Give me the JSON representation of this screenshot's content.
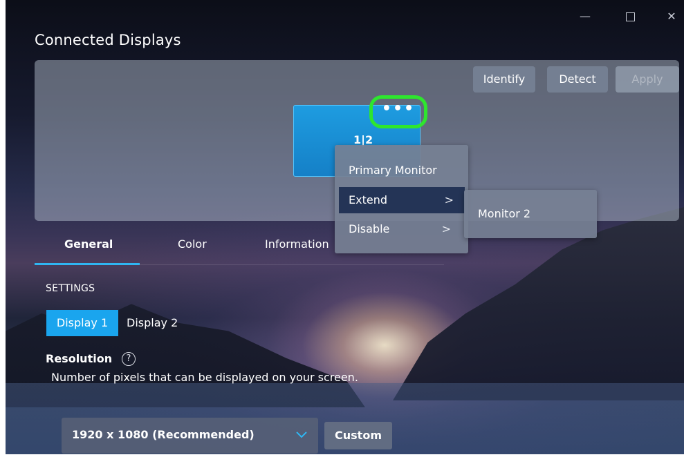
{
  "window": {
    "title": "Connected Displays",
    "controls": {
      "minimize": "—",
      "close": "✕"
    }
  },
  "top_actions": {
    "identify": "Identify",
    "detect": "Detect",
    "apply": "Apply"
  },
  "display_arrangement": {
    "monitor_label": "1|2",
    "more_button": "•••"
  },
  "context_menu": {
    "items": [
      {
        "label": "Primary Monitor"
      },
      {
        "label": "Extend",
        "submenu_arrow": ">"
      },
      {
        "label": "Disable",
        "submenu_arrow": ">"
      }
    ],
    "selected": "Extend"
  },
  "submenu": {
    "items": [
      {
        "label": "Monitor 2"
      }
    ]
  },
  "tabs": {
    "items": [
      {
        "label": "General"
      },
      {
        "label": "Color"
      },
      {
        "label": "Information"
      }
    ],
    "active": "General"
  },
  "settings": {
    "section_label": "SETTINGS",
    "display_tabs": [
      {
        "label": "Display 1"
      },
      {
        "label": "Display 2"
      }
    ],
    "active_display": "Display 1",
    "resolution": {
      "heading": "Resolution",
      "help_icon": "?",
      "description": "Number of pixels that can be displayed on your screen.",
      "selected_value": "1920 x 1080 (Recommended)",
      "custom_button": "Custom"
    }
  },
  "colors": {
    "accent": "#1aa5ee",
    "tab_underline": "#2fb6f2",
    "highlight_ring": "#2ee62e",
    "menu_selected": "#243456"
  }
}
